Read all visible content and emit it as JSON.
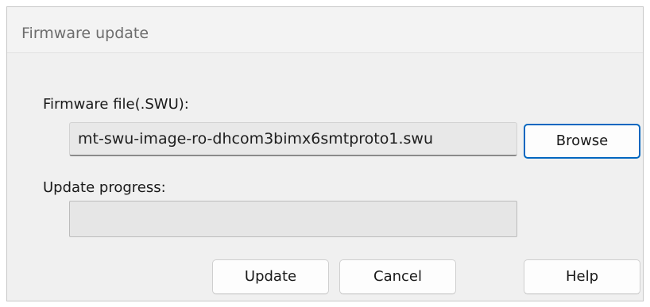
{
  "dialog": {
    "title": "Firmware update",
    "firmware_label": "Firmware file(.SWU):",
    "firmware_value": "mt-swu-image-ro-dhcom3bimx6smtproto1.swu",
    "progress_label": "Update progress:",
    "progress_fraction": 0
  },
  "buttons": {
    "browse": "Browse",
    "update": "Update",
    "cancel": "Cancel",
    "help": "Help"
  },
  "colors": {
    "default_button_border": "#0067c0",
    "dialog_background": "#f0f0f0"
  }
}
